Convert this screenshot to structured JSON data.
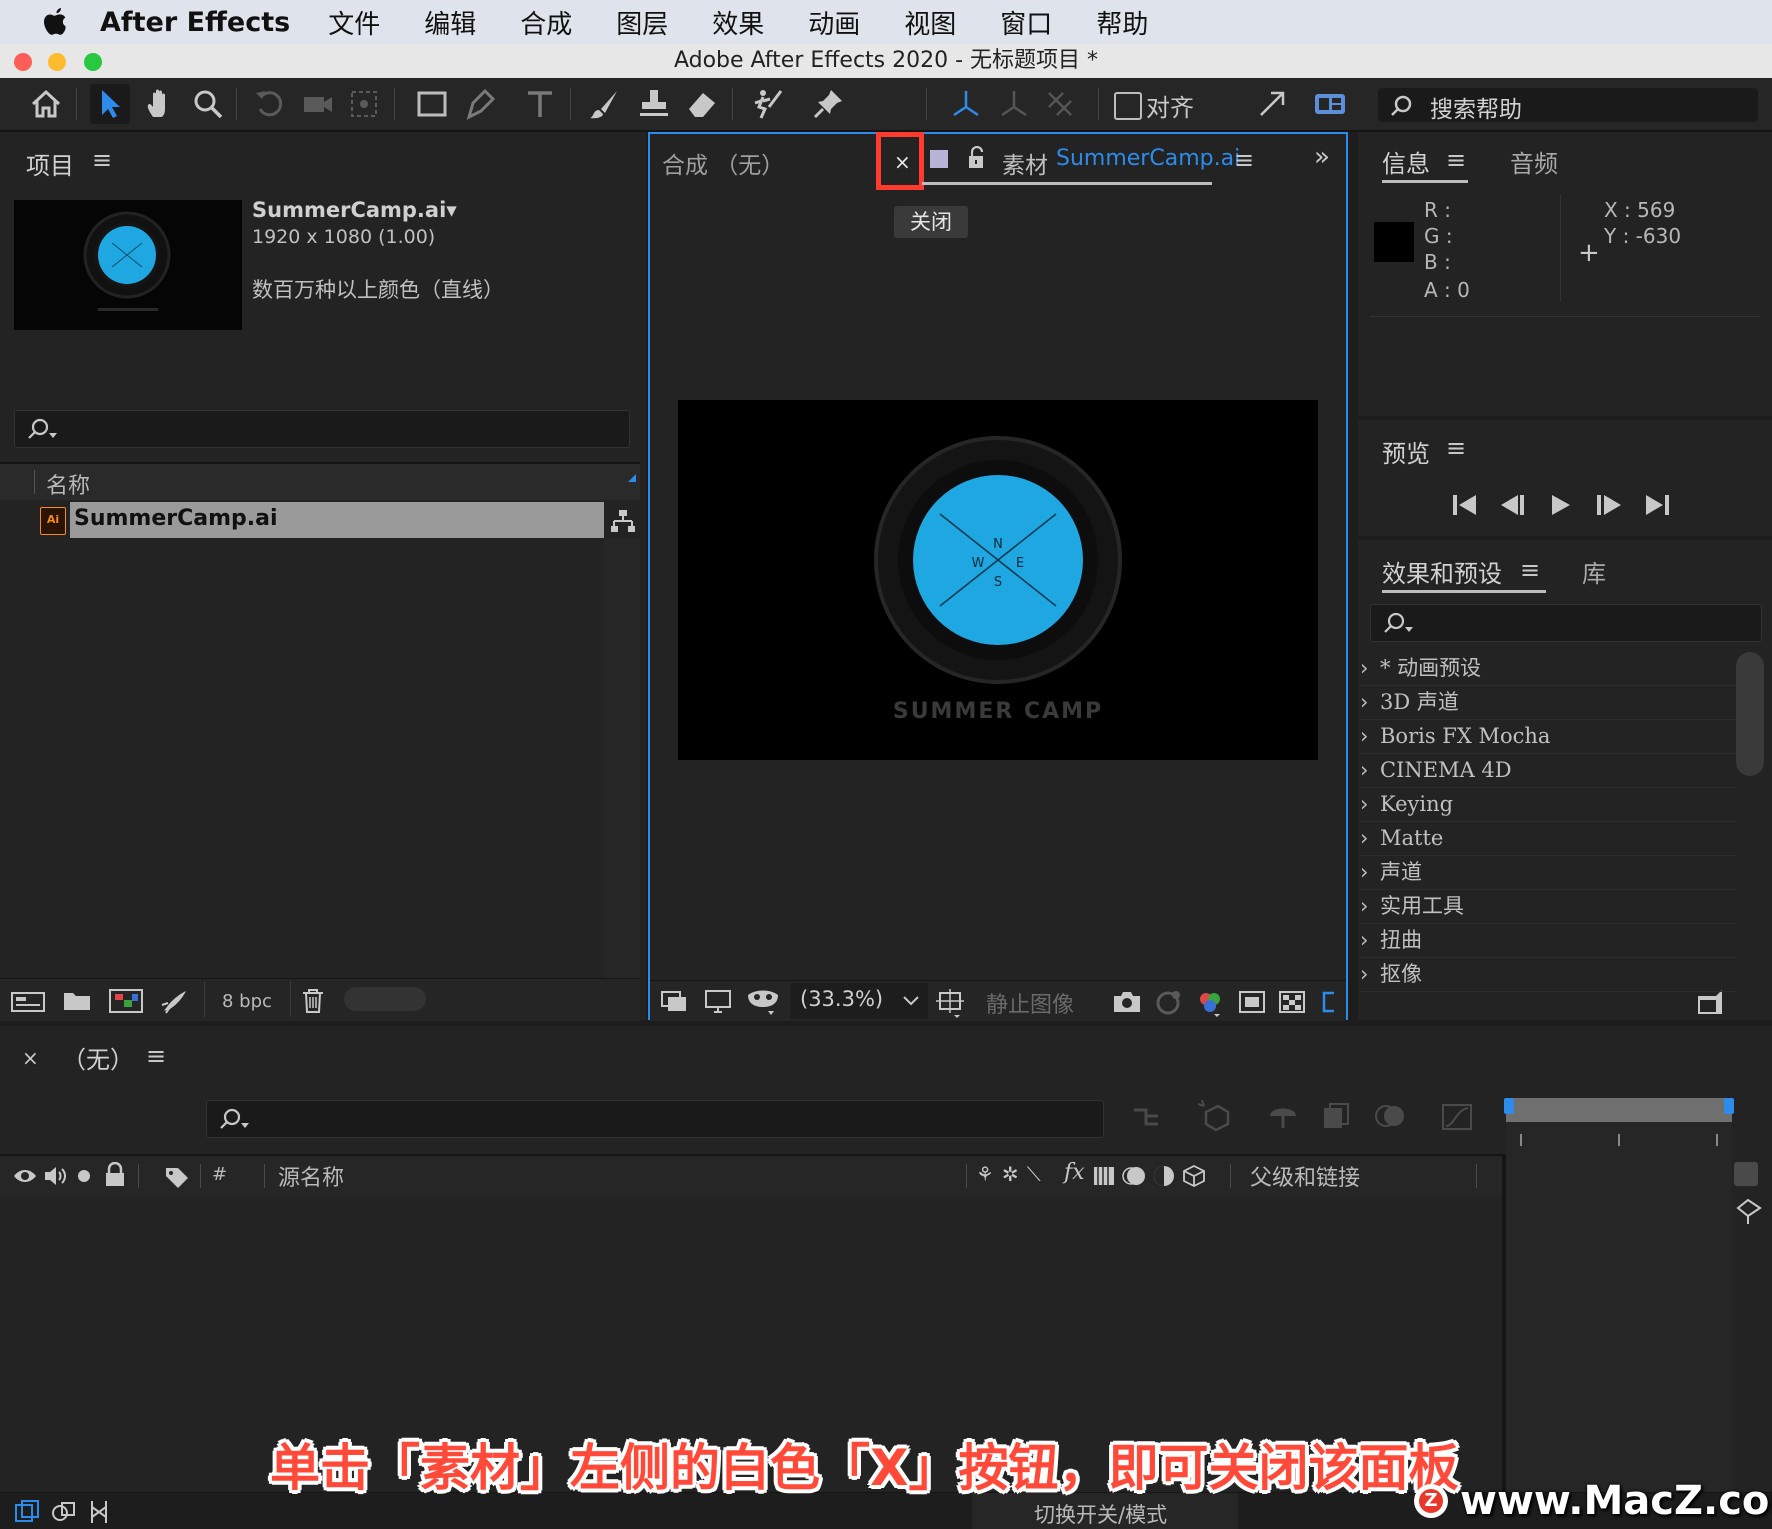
{
  "menubar": {
    "app_name": "After Effects",
    "items": [
      "文件",
      "编辑",
      "合成",
      "图层",
      "效果",
      "动画",
      "视图",
      "窗口",
      "帮助"
    ]
  },
  "window": {
    "title": "Adobe After Effects 2020 - 无标题项目 *"
  },
  "toolbar": {
    "align_label": "对齐",
    "search_placeholder": "搜索帮助"
  },
  "project_panel": {
    "title": "项目",
    "file_name": "SummerCamp.ai▾",
    "dimensions": "1920 x 1080 (1.00)",
    "color_info": "数百万种以上颜色（直线）",
    "column_name": "名称",
    "items": [
      {
        "name": "SummerCamp.ai"
      }
    ],
    "bpc": "8 bpc"
  },
  "viewer": {
    "comp_tab": "合成 （无）",
    "close_tooltip": "关闭",
    "footage_prefix": "素材",
    "footage_name": "SummerCamp.ai",
    "zoom": "(33.3%)",
    "still_image": "静止图像",
    "logo_text": "SUMMER CAMP",
    "compass": [
      "N",
      "W",
      "E",
      "S"
    ]
  },
  "info_panel": {
    "tab_info": "信息",
    "tab_audio": "音频",
    "r": "R :",
    "g": "G :",
    "b": "B :",
    "a": "A :  0",
    "x": "X :  569",
    "y": "Y :  -630"
  },
  "preview_panel": {
    "title": "预览"
  },
  "effects_panel": {
    "tab_effects": "效果和预设",
    "tab_library": "库",
    "items": [
      "* 动画预设",
      "3D 声道",
      "Boris FX Mocha",
      "CINEMA 4D",
      "Keying",
      "Matte",
      "声道",
      "实用工具",
      "扭曲",
      "抠像"
    ]
  },
  "timeline": {
    "tab": "（无）",
    "col_source": "源名称",
    "col_hash": "#",
    "col_parent": "父级和链接",
    "toggle_label": "切换开关/模式"
  },
  "caption": "单击「素材」左侧的白色「X」按钮，即可关闭该面板",
  "watermark": "www.MacZ.com",
  "colors": {
    "accent_blue": "#2d8ceb",
    "highlight_red": "#ff3b30",
    "logo_cyan": "#1ea7e1"
  }
}
